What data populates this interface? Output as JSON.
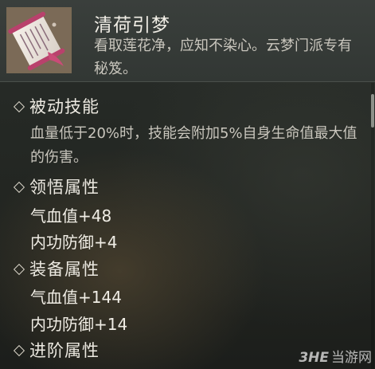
{
  "item": {
    "name": "清荷引梦",
    "description": "看取莲花净，应知不染心。云梦门派专有秘笈。",
    "icon": "scroll-icon"
  },
  "sections": {
    "passive": {
      "title": "被动技能",
      "text": "血量低于20%时，技能会附加5%自身生命值最大值的伤害。"
    },
    "comprehension": {
      "title": "领悟属性",
      "stats": [
        "气血值+48",
        "内功防御+4"
      ]
    },
    "equipment": {
      "title": "装备属性",
      "stats": [
        "气血值+144",
        "内功防御+14"
      ]
    },
    "advanced": {
      "title": "进阶属性"
    }
  },
  "watermark": {
    "logo": "3HE",
    "site": "当游网"
  },
  "colors": {
    "title": "#f1eee6",
    "description": "#c9c6bd",
    "stat": "#f0ede5"
  }
}
